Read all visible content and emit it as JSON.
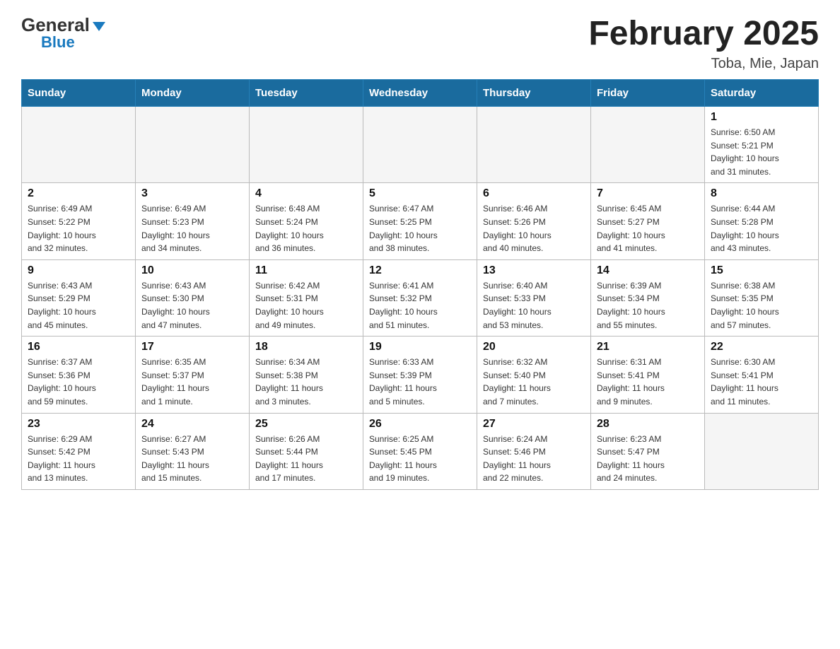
{
  "header": {
    "logo_general": "General",
    "logo_blue": "Blue",
    "month_title": "February 2025",
    "location": "Toba, Mie, Japan"
  },
  "days_of_week": [
    "Sunday",
    "Monday",
    "Tuesday",
    "Wednesday",
    "Thursday",
    "Friday",
    "Saturday"
  ],
  "weeks": [
    [
      {
        "day": "",
        "info": ""
      },
      {
        "day": "",
        "info": ""
      },
      {
        "day": "",
        "info": ""
      },
      {
        "day": "",
        "info": ""
      },
      {
        "day": "",
        "info": ""
      },
      {
        "day": "",
        "info": ""
      },
      {
        "day": "1",
        "info": "Sunrise: 6:50 AM\nSunset: 5:21 PM\nDaylight: 10 hours\nand 31 minutes."
      }
    ],
    [
      {
        "day": "2",
        "info": "Sunrise: 6:49 AM\nSunset: 5:22 PM\nDaylight: 10 hours\nand 32 minutes."
      },
      {
        "day": "3",
        "info": "Sunrise: 6:49 AM\nSunset: 5:23 PM\nDaylight: 10 hours\nand 34 minutes."
      },
      {
        "day": "4",
        "info": "Sunrise: 6:48 AM\nSunset: 5:24 PM\nDaylight: 10 hours\nand 36 minutes."
      },
      {
        "day": "5",
        "info": "Sunrise: 6:47 AM\nSunset: 5:25 PM\nDaylight: 10 hours\nand 38 minutes."
      },
      {
        "day": "6",
        "info": "Sunrise: 6:46 AM\nSunset: 5:26 PM\nDaylight: 10 hours\nand 40 minutes."
      },
      {
        "day": "7",
        "info": "Sunrise: 6:45 AM\nSunset: 5:27 PM\nDaylight: 10 hours\nand 41 minutes."
      },
      {
        "day": "8",
        "info": "Sunrise: 6:44 AM\nSunset: 5:28 PM\nDaylight: 10 hours\nand 43 minutes."
      }
    ],
    [
      {
        "day": "9",
        "info": "Sunrise: 6:43 AM\nSunset: 5:29 PM\nDaylight: 10 hours\nand 45 minutes."
      },
      {
        "day": "10",
        "info": "Sunrise: 6:43 AM\nSunset: 5:30 PM\nDaylight: 10 hours\nand 47 minutes."
      },
      {
        "day": "11",
        "info": "Sunrise: 6:42 AM\nSunset: 5:31 PM\nDaylight: 10 hours\nand 49 minutes."
      },
      {
        "day": "12",
        "info": "Sunrise: 6:41 AM\nSunset: 5:32 PM\nDaylight: 10 hours\nand 51 minutes."
      },
      {
        "day": "13",
        "info": "Sunrise: 6:40 AM\nSunset: 5:33 PM\nDaylight: 10 hours\nand 53 minutes."
      },
      {
        "day": "14",
        "info": "Sunrise: 6:39 AM\nSunset: 5:34 PM\nDaylight: 10 hours\nand 55 minutes."
      },
      {
        "day": "15",
        "info": "Sunrise: 6:38 AM\nSunset: 5:35 PM\nDaylight: 10 hours\nand 57 minutes."
      }
    ],
    [
      {
        "day": "16",
        "info": "Sunrise: 6:37 AM\nSunset: 5:36 PM\nDaylight: 10 hours\nand 59 minutes."
      },
      {
        "day": "17",
        "info": "Sunrise: 6:35 AM\nSunset: 5:37 PM\nDaylight: 11 hours\nand 1 minute."
      },
      {
        "day": "18",
        "info": "Sunrise: 6:34 AM\nSunset: 5:38 PM\nDaylight: 11 hours\nand 3 minutes."
      },
      {
        "day": "19",
        "info": "Sunrise: 6:33 AM\nSunset: 5:39 PM\nDaylight: 11 hours\nand 5 minutes."
      },
      {
        "day": "20",
        "info": "Sunrise: 6:32 AM\nSunset: 5:40 PM\nDaylight: 11 hours\nand 7 minutes."
      },
      {
        "day": "21",
        "info": "Sunrise: 6:31 AM\nSunset: 5:41 PM\nDaylight: 11 hours\nand 9 minutes."
      },
      {
        "day": "22",
        "info": "Sunrise: 6:30 AM\nSunset: 5:41 PM\nDaylight: 11 hours\nand 11 minutes."
      }
    ],
    [
      {
        "day": "23",
        "info": "Sunrise: 6:29 AM\nSunset: 5:42 PM\nDaylight: 11 hours\nand 13 minutes."
      },
      {
        "day": "24",
        "info": "Sunrise: 6:27 AM\nSunset: 5:43 PM\nDaylight: 11 hours\nand 15 minutes."
      },
      {
        "day": "25",
        "info": "Sunrise: 6:26 AM\nSunset: 5:44 PM\nDaylight: 11 hours\nand 17 minutes."
      },
      {
        "day": "26",
        "info": "Sunrise: 6:25 AM\nSunset: 5:45 PM\nDaylight: 11 hours\nand 19 minutes."
      },
      {
        "day": "27",
        "info": "Sunrise: 6:24 AM\nSunset: 5:46 PM\nDaylight: 11 hours\nand 22 minutes."
      },
      {
        "day": "28",
        "info": "Sunrise: 6:23 AM\nSunset: 5:47 PM\nDaylight: 11 hours\nand 24 minutes."
      },
      {
        "day": "",
        "info": ""
      }
    ]
  ]
}
